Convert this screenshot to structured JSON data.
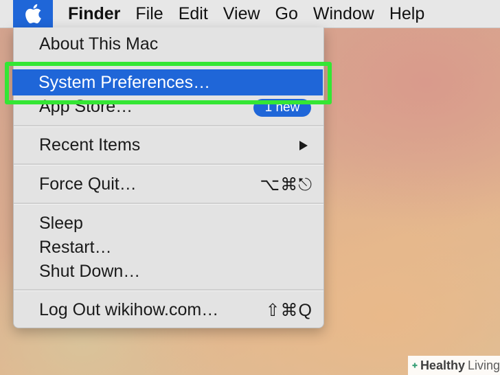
{
  "menubar": {
    "apple_icon": "apple-logo",
    "items": [
      "Finder",
      "File",
      "Edit",
      "View",
      "Go",
      "Window",
      "Help"
    ]
  },
  "apple_menu": {
    "about": "About This Mac",
    "system_preferences": "System Preferences…",
    "app_store": "App Store…",
    "app_store_badge": "1 new",
    "recent_items": "Recent Items",
    "force_quit": "Force Quit…",
    "force_quit_shortcut": "⌥⌘⎋",
    "sleep": "Sleep",
    "restart": "Restart…",
    "shut_down": "Shut Down…",
    "log_out": "Log Out wikihow.com…",
    "log_out_shortcut": "⇧⌘Q"
  },
  "highlight_color": "#34e634",
  "accent_color": "#1f66d8",
  "watermark": {
    "brand_bold": "Healthy",
    "brand": "Living"
  }
}
